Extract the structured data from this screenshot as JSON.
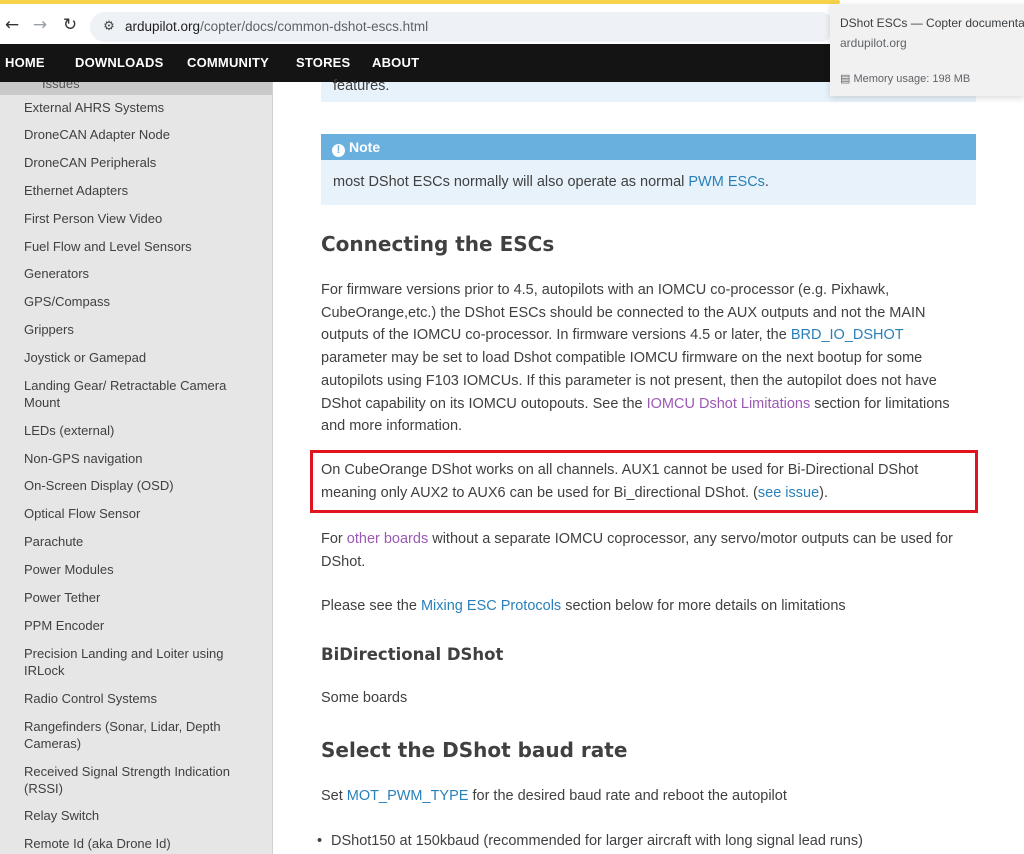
{
  "browser": {
    "url_host": "ardupilot.org",
    "url_path": "/copter/docs/common-dshot-escs.html",
    "back_icon": "back-arrow-icon",
    "forward_icon": "forward-arrow-icon",
    "reload_icon": "reload-icon",
    "site_info_icon": "site-settings-icon",
    "hover_card": {
      "title": "DShot ESCs — Copter documentation",
      "domain": "ardupilot.org",
      "memory": "Memory usage: 198 MB"
    }
  },
  "nav": {
    "items": [
      "HOME",
      "DOWNLOADS",
      "COMMUNITY",
      "STORES",
      "ABOUT"
    ]
  },
  "sidebar": {
    "cut_item": "Issues",
    "items": [
      "External AHRS Systems",
      "DroneCAN Adapter Node",
      "DroneCAN Peripherals",
      "Ethernet Adapters",
      "First Person View Video",
      "Fuel Flow and Level Sensors",
      "Generators",
      "GPS/Compass",
      "Grippers",
      "Joystick or Gamepad",
      "Landing Gear/ Retractable Camera Mount",
      "LEDs (external)",
      "Non-GPS navigation",
      "On-Screen Display (OSD)",
      "Optical Flow Sensor",
      "Parachute",
      "Power Modules",
      "Power Tether",
      "PPM Encoder",
      "Precision Landing and Loiter using IRLock",
      "Radio Control Systems",
      "Rangefinders (Sonar, Lidar, Depth Cameras)",
      "Received Signal Strength Indication (RSSI)",
      "Relay Switch",
      "Remote Id (aka Drone Id)"
    ]
  },
  "content": {
    "top_note_tail": "features.",
    "note": {
      "title": "Note",
      "body_pre": "most DShot ESCs normally will also operate as normal ",
      "body_link": "PWM ESCs",
      "body_post": "."
    },
    "h_connecting": "Connecting the ESCs",
    "p1": {
      "l1": "For firmware versions prior to 4.5, autopilots with an IOMCU co-processor (e.g. Pixhawk,",
      "l2": "CubeOrange,etc.) the DShot ESCs should be connected to the AUX outputs and not the MAIN",
      "l3_pre": "outputs of the IOMCU co-processor. In firmware versions 4.5 or later, the ",
      "l3_link": "BRD_IO_DSHOT",
      "l4": "parameter may be set to load Dshot compatible IOMCU firmware on the next bootup for some",
      "l5": "autopilots using F103 IOMCUs. If this parameter is not present, then the autopilot does not have",
      "l6_pre": "DShot capability on its IOMCU outopouts. See the ",
      "l6_link": "IOMCU Dshot Limitations",
      "l6_post": " section for limitations",
      "l7": "and more information."
    },
    "p2": {
      "l1": "On CubeOrange DShot works on all channels. AUX1 cannot be used for Bi-Directional DShot",
      "l2_pre": "meaning only AUX2 to AUX6 can be used for Bi_directional DShot. (",
      "l2_link": "see issue",
      "l2_post": ")."
    },
    "p3": {
      "l1_pre": "For ",
      "l1_link": "other boards",
      "l1_post": " without a separate IOMCU coprocessor, any servo/motor outputs can be used for",
      "l2": "DShot."
    },
    "p4": {
      "pre": "Please see the ",
      "link": "Mixing ESC Protocols",
      "post": " section below for more details on limitations"
    },
    "h_bidir": "BiDirectional DShot",
    "p5": "Some boards",
    "h_baud": "Select the DShot baud rate",
    "p6": {
      "pre": "Set ",
      "link": "MOT_PWM_TYPE",
      "post": " for the desired baud rate and reboot the autopilot"
    },
    "bullet1": "DShot150 at 150kbaud (recommended for larger aircraft with long signal lead runs)"
  },
  "colors": {
    "nav_bg": "#141414",
    "note_title_bg": "#6ab0de",
    "note_bg": "#e7f2fa",
    "link": "#2980b9",
    "visited_link": "#9b59b6",
    "highlight_box": "#e0141e",
    "sidebar_bg": "#e6e6e6"
  }
}
